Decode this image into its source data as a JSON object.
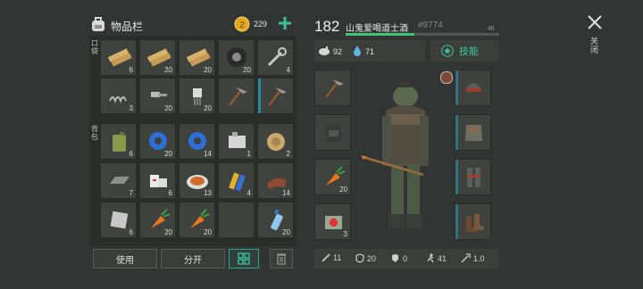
{
  "inventory": {
    "title": "物品栏",
    "coins": "229",
    "add_icon": "plus-icon",
    "pocket_label": "口袋",
    "backpack_label": "背包",
    "pocket_slots": [
      {
        "item": "wood-planks-icon",
        "count": "6"
      },
      {
        "item": "wood-planks-icon",
        "count": "20"
      },
      {
        "item": "wood-planks-icon",
        "count": "20"
      },
      {
        "item": "tire-icon",
        "count": "20"
      },
      {
        "item": "wrench-icon",
        "count": "4"
      },
      {
        "item": "spring-icon",
        "count": "3"
      },
      {
        "item": "nuts-bolts-icon",
        "count": "20"
      },
      {
        "item": "electronic-part-icon",
        "count": "20"
      },
      {
        "item": "stone-pickaxe-icon",
        "count": ""
      },
      {
        "item": "stone-pickaxe-icon",
        "count": ""
      }
    ],
    "backpack_slots": [
      {
        "item": "fuel-can-icon",
        "count": "6"
      },
      {
        "item": "duct-tape-icon",
        "count": "20"
      },
      {
        "item": "duct-tape-icon",
        "count": "14"
      },
      {
        "item": "engine-part-icon",
        "count": "1"
      },
      {
        "item": "rope-coil-icon",
        "count": "2"
      },
      {
        "item": "iron-bar-icon",
        "count": "7"
      },
      {
        "item": "bandage-icon",
        "count": "6"
      },
      {
        "item": "food-plate-icon",
        "count": "13"
      },
      {
        "item": "battery-icon",
        "count": "4"
      },
      {
        "item": "leather-icon",
        "count": "14"
      },
      {
        "item": "metal-sheet-icon",
        "count": "6"
      },
      {
        "item": "carrot-icon",
        "count": "20"
      },
      {
        "item": "carrot-icon",
        "count": "20"
      },
      {
        "item": "",
        "count": ""
      },
      {
        "item": "water-bottle-icon",
        "count": "20"
      }
    ],
    "use_button": "使用",
    "split_button": "分开",
    "sort_icon": "sort-grid-icon",
    "trash_icon": "trash-icon"
  },
  "character": {
    "level": "182",
    "name": "山鬼爱喝道士酒",
    "id": "#9774",
    "xp_value": "46",
    "xp_progress": 0.45,
    "food": "92",
    "water": "71",
    "skills_label": "技能",
    "close_label": "关闭",
    "quick_slots": [
      {
        "item": "stone-pickaxe-icon",
        "count": ""
      },
      {
        "item": "backpack-icon",
        "count": ""
      },
      {
        "item": "carrot-icon",
        "count": "20"
      },
      {
        "item": "medkit-icon",
        "count": "3"
      }
    ],
    "equipment": [
      "helmet-icon",
      "chest-armor-icon",
      "leg-armor-icon",
      "boots-icon"
    ],
    "stats": {
      "attack": "11",
      "defense": "20",
      "armor": "0",
      "speed": "41",
      "crit": "1.0"
    }
  }
}
